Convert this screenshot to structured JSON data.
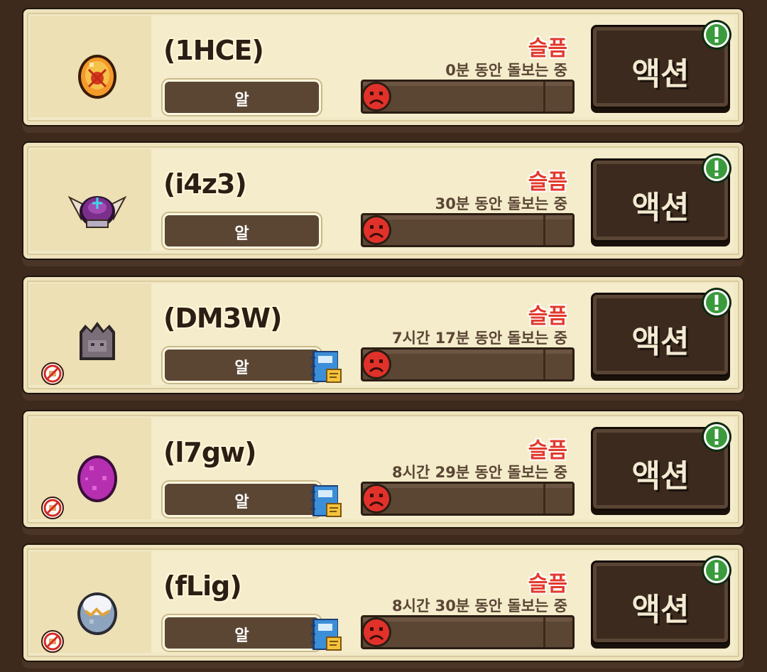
{
  "pets": [
    {
      "name": "(1HCE)",
      "type": "알",
      "mood": "슬픔",
      "care": "0분 동안 돌보는 중",
      "action": "액션",
      "icon": "orange-egg-icon",
      "has_ban": false,
      "has_book": false
    },
    {
      "name": "(i4z3)",
      "type": "알",
      "mood": "슬픔",
      "care": "30분 동안 돌보는 중",
      "action": "액션",
      "icon": "winged-helmet-icon",
      "has_ban": false,
      "has_book": false
    },
    {
      "name": "(DM3W)",
      "type": "알",
      "mood": "슬픔",
      "care": "7시간 17분 동안 돌보는 중",
      "action": "액션",
      "icon": "stone-egg-icon",
      "has_ban": true,
      "has_book": true
    },
    {
      "name": "(l7gw)",
      "type": "알",
      "mood": "슬픔",
      "care": "8시간 29분 동안 돌보는 중",
      "action": "액션",
      "icon": "purple-egg-icon",
      "has_ban": true,
      "has_book": true
    },
    {
      "name": "(fLig)",
      "type": "알",
      "mood": "슬픔",
      "care": "8시간 30분 동안 돌보는 중",
      "action": "액션",
      "icon": "cracked-egg-icon",
      "has_ban": true,
      "has_book": true
    }
  ],
  "colors": {
    "background": "#3d2a1c",
    "card": "#f1e8c6",
    "mood_red": "#e23a2c",
    "alert_green": "#3a9b3c"
  }
}
